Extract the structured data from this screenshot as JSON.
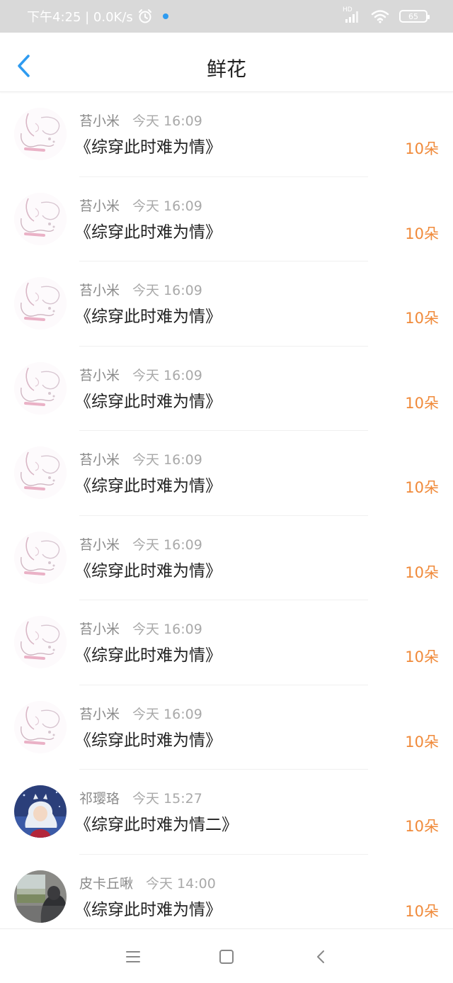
{
  "status": {
    "time_speed": "下午4:25 | 0.0K/s",
    "network": "HD",
    "battery": "65"
  },
  "header": {
    "title": "鲜花"
  },
  "items": [
    {
      "name": "苔小米",
      "time": "今天 16:09",
      "book": "《综穿此时难为情》",
      "amount": "10朵",
      "avatar": "bunny-sketch"
    },
    {
      "name": "苔小米",
      "time": "今天 16:09",
      "book": "《综穿此时难为情》",
      "amount": "10朵",
      "avatar": "bunny-sketch"
    },
    {
      "name": "苔小米",
      "time": "今天 16:09",
      "book": "《综穿此时难为情》",
      "amount": "10朵",
      "avatar": "bunny-sketch"
    },
    {
      "name": "苔小米",
      "time": "今天 16:09",
      "book": "《综穿此时难为情》",
      "amount": "10朵",
      "avatar": "bunny-sketch"
    },
    {
      "name": "苔小米",
      "time": "今天 16:09",
      "book": "《综穿此时难为情》",
      "amount": "10朵",
      "avatar": "bunny-sketch"
    },
    {
      "name": "苔小米",
      "time": "今天 16:09",
      "book": "《综穿此时难为情》",
      "amount": "10朵",
      "avatar": "bunny-sketch"
    },
    {
      "name": "苔小米",
      "time": "今天 16:09",
      "book": "《综穿此时难为情》",
      "amount": "10朵",
      "avatar": "bunny-sketch"
    },
    {
      "name": "苔小米",
      "time": "今天 16:09",
      "book": "《综穿此时难为情》",
      "amount": "10朵",
      "avatar": "bunny-sketch"
    },
    {
      "name": "祁璎珞",
      "time": "今天 15:27",
      "book": "《综穿此时难为情二》",
      "amount": "10朵",
      "avatar": "anime-character"
    },
    {
      "name": "皮卡丘啾",
      "time": "今天 14:00",
      "book": "《综穿此时难为情》",
      "amount": "10朵",
      "avatar": "window-photo"
    }
  ],
  "colors": {
    "accent": "#2e9bf0",
    "amount": "#f08a3a",
    "status_bar": "#d9d9d9"
  }
}
